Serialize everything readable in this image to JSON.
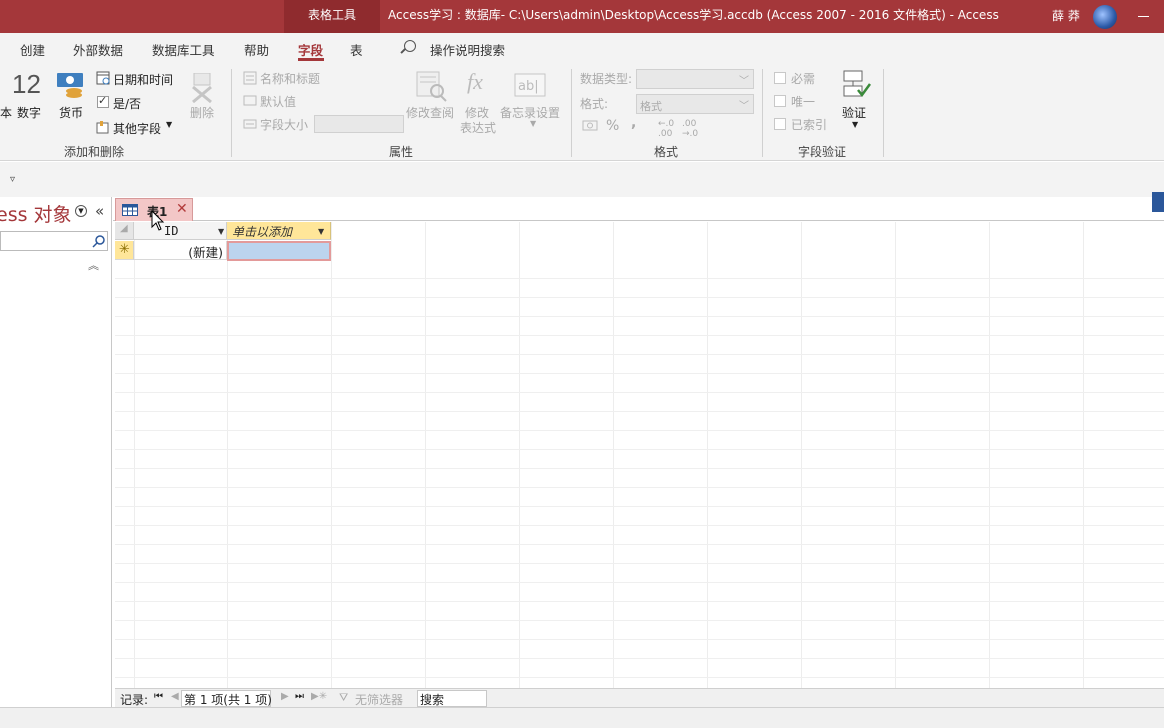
{
  "titlebar": {
    "tools_label": "表格工具",
    "title": "Access学习 : 数据库- C:\\Users\\admin\\Desktop\\Access学习.accdb (Access 2007 - 2016 文件格式)  -  Access",
    "user": "薛 莽"
  },
  "ribbon_tabs": [
    "创建",
    "外部数据",
    "数据库工具",
    "帮助",
    "字段",
    "表"
  ],
  "active_tab": "字段",
  "tell_me": "操作说明搜索",
  "ribbon": {
    "add_delete": {
      "text_partial": "本",
      "number_icon": "12",
      "number_label": "数字",
      "currency_label": "货币",
      "datetime_label": "日期和时间",
      "yesno_label": "是/否",
      "other_label": "其他字段",
      "delete_label": "删除",
      "group_label": "添加和删除"
    },
    "properties": {
      "name_caption": "名称和标题",
      "default_value": "默认值",
      "field_size": "字段大小",
      "modify_lookup": "修改查阅",
      "modify_expr_1": "修改",
      "modify_expr_2": "表达式",
      "memo_settings": "备忘录设置",
      "group_label": "属性"
    },
    "formatting": {
      "data_type_label": "数据类型:",
      "format_label": "格式:",
      "format_value": "格式",
      "group_label": "格式"
    },
    "validation": {
      "required": "必需",
      "unique": "唯一",
      "indexed": "已索引",
      "validate": "验证",
      "group_label": "字段验证"
    }
  },
  "nav": {
    "title": "ess 对象",
    "collapse": "«"
  },
  "doc_tab": {
    "label": "表1",
    "close": "✕"
  },
  "grid": {
    "col_id": "ID",
    "col_add": "单击以添加",
    "new_row_id": "(新建)"
  },
  "recnav": {
    "label": "记录:",
    "current": "第 1 项(共 1 项)",
    "filter": "无筛选器",
    "search": "搜索"
  },
  "colors": {
    "accent": "#a4373a",
    "header_add": "#ffe699",
    "selected_cell": "#bcd4ee"
  }
}
